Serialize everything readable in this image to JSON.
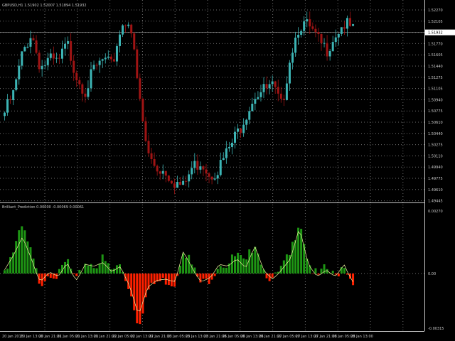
{
  "header": {
    "symbol_info": "GBPUSD,H1  1.51902 1.52007 1.51894 1.51932"
  },
  "indicator": {
    "info": "Brilliant_Prediction 0.00000 -0.00069 0.00061"
  },
  "colors": {
    "bull": "#3cb4b4",
    "bear": "#a01414",
    "hist_up": "#1e9614",
    "hist_down": "#ff2000",
    "signal": "#f0f0a0",
    "grid": "#6e6e6e",
    "axis": "#c8c8c8"
  },
  "chart_data": [
    {
      "type": "candlestick",
      "title": "GBPUSD,H1",
      "ylim": [
        1.494,
        1.5235
      ],
      "price_labels": [
        "1.52270",
        "1.52105",
        "1.51932",
        "1.51770",
        "1.51605",
        "1.51440",
        "1.51275",
        "1.51105",
        "1.50940",
        "1.50775",
        "1.50610",
        "1.50440",
        "1.50275",
        "1.50110",
        "1.49940",
        "1.49775",
        "1.49610",
        "1.49445"
      ],
      "current_price": "1.51932",
      "close_keypoints": [
        1.5072,
        1.51,
        1.516,
        1.5192,
        1.514,
        1.515,
        1.5145,
        1.5175,
        1.513,
        1.5105,
        1.5135,
        1.515,
        1.514,
        1.52,
        1.5215,
        1.51,
        1.501,
        1.499,
        1.4985,
        1.497,
        1.496,
        1.499,
        1.5,
        1.498,
        1.499,
        1.5015,
        1.504,
        1.507,
        1.51,
        1.5105,
        1.511,
        1.508,
        1.516,
        1.5205,
        1.52,
        1.518,
        1.5165,
        1.519,
        1.5205,
        1.5195
      ],
      "time_labels": [
        "20 Jan 2015",
        "20 Jan 13:00",
        "20 Jan 21:00",
        "21 Jan 05:00",
        "21 Jan 13:00",
        "21 Jan 21:00",
        "22 Jan 05:00",
        "22 Jan 13:00",
        "22 Jan 21:00",
        "23 Jan 05:00",
        "23 Jan 13:00",
        "23 Jan 21:00",
        "26 Jan 05:00",
        "26 Jan 13:00",
        "26 Jan 21:00",
        "27 Jan 05:00",
        "27 Jan 13:00",
        "27 Jan 21:00",
        "28 Jan 05:00",
        "28 Jan 13:00"
      ]
    },
    {
      "type": "histogram",
      "title": "Brilliant_Prediction",
      "ylim": [
        -0.00315,
        0.0027
      ],
      "axis_labels": [
        "0.00270",
        "0.00",
        "-0.00315"
      ],
      "value_keypoints": [
        0.0002,
        0.001,
        0.002,
        0.0008,
        -0.0006,
        0.0001,
        -0.0002,
        0.0006,
        -0.0005,
        0.0005,
        0.0004,
        0.0006,
        0.0001,
        0.0004,
        -0.0009,
        -0.003,
        -0.001,
        -0.0005,
        -0.0004,
        -0.0006,
        0.0012,
        0.0003,
        -0.0006,
        -0.0003,
        0.0005,
        0.0004,
        0.0008,
        0.0003,
        0.0015,
        0.0002,
        -0.0004,
        0.0002,
        0.0008,
        0.0025,
        0.0005,
        -0.0002,
        0.0002,
        -0.0002,
        0.0005,
        -0.0006
      ]
    }
  ]
}
